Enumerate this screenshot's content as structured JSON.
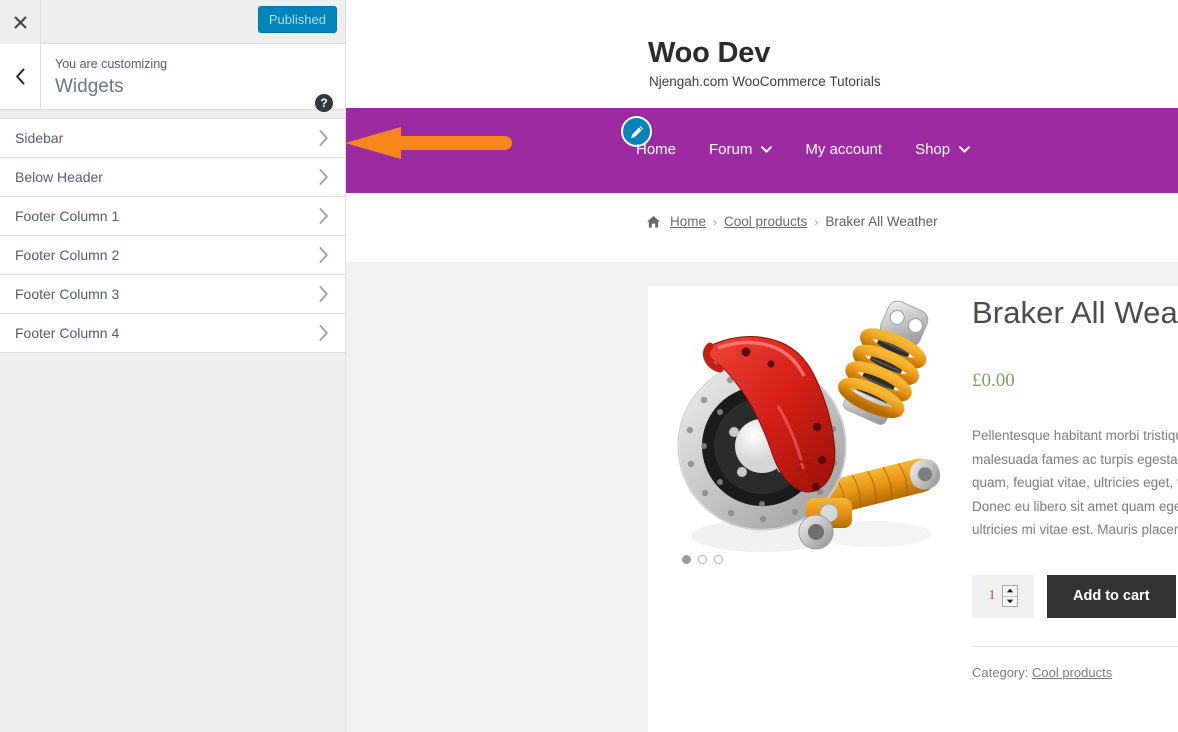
{
  "customizer": {
    "close_icon": "close-x-icon",
    "publish_label": "Published",
    "back_icon": "chevron-left-icon",
    "customizing_label": "You are customizing",
    "panel_title": "Widgets",
    "help_icon": "help-question-icon",
    "accent_color": "#0085ba",
    "items": [
      {
        "label": "Sidebar",
        "chevron": "chevron-right-icon"
      },
      {
        "label": "Below Header",
        "chevron": "chevron-right-icon"
      },
      {
        "label": "Footer Column 1",
        "chevron": "chevron-right-icon"
      },
      {
        "label": "Footer Column 2",
        "chevron": "chevron-right-icon"
      },
      {
        "label": "Footer Column 3",
        "chevron": "chevron-right-icon"
      },
      {
        "label": "Footer Column 4",
        "chevron": "chevron-right-icon"
      }
    ]
  },
  "annotation": {
    "arrow_icon": "left-arrow-annotation",
    "color": "#f7861c",
    "points_to": "Sidebar"
  },
  "preview": {
    "site_title": "Woo Dev",
    "tagline": "Njengah.com WooCommerce Tutorials",
    "nav_bg": "#9c2aa0",
    "edit_shortcut_icon": "pencil-edit-icon",
    "nav": [
      {
        "label": "Home",
        "has_caret": false
      },
      {
        "label": "Forum",
        "has_caret": true
      },
      {
        "label": "My account",
        "has_caret": false
      },
      {
        "label": "Shop",
        "has_caret": true
      }
    ],
    "breadcrumb": {
      "home_icon": "home-icon",
      "home": "Home",
      "sep": "›",
      "category": "Cool products",
      "current": "Braker All Weather"
    },
    "product": {
      "gallery_image_alt": "red brake caliper disc and yellow coil spring suspension",
      "gallery_dots": 3,
      "active_dot": 1,
      "title": "Braker All Weather",
      "price": "£0.00",
      "description_lines": [
        "Pellentesque habitant morbi tristique senectus et netus et",
        "malesuada fames ac turpis egestas. Vestibulum tortor",
        "quam, feugiat vitae, ultricies eget, tempor sit amet, ante.",
        "Donec eu libero sit amet quam egestas semper. Aenean",
        "ultricies mi vitae est. Mauris placerat eleifend leo."
      ],
      "quantity": "1",
      "qty_up_icon": "spinner-up-icon",
      "qty_down_icon": "spinner-down-icon",
      "add_to_cart_label": "Add to cart",
      "meta_label": "Category:",
      "meta_value": "Cool products"
    }
  }
}
